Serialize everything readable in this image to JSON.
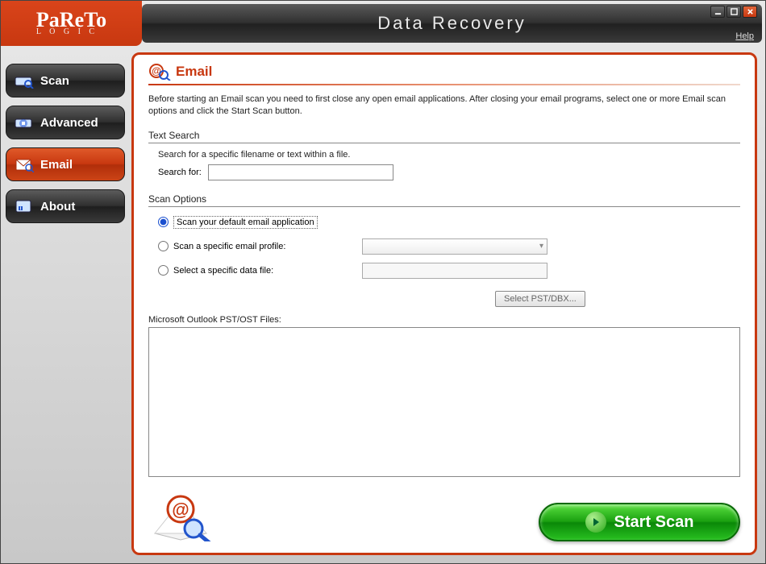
{
  "app": {
    "logo_top": "PaReTo",
    "logo_sub": "L O G I C",
    "title": "Data Recovery",
    "help": "Help"
  },
  "sidebar": {
    "items": [
      {
        "label": "Scan",
        "icon": "drive-scan-icon"
      },
      {
        "label": "Advanced",
        "icon": "drive-advanced-icon"
      },
      {
        "label": "Email",
        "icon": "email-icon"
      },
      {
        "label": "About",
        "icon": "about-icon"
      }
    ],
    "active_index": 2
  },
  "panel": {
    "title": "Email",
    "intro": "Before starting an Email scan you need to first close any open email applications. After closing your email programs, select one or more Email scan options and click the Start Scan button.",
    "text_search": {
      "heading": "Text Search",
      "hint": "Search for a specific filename or text within a file.",
      "label": "Search for:",
      "value": ""
    },
    "scan_options": {
      "heading": "Scan Options",
      "opt1": "Scan your default email application",
      "opt2": "Scan a specific email profile:",
      "opt3": "Select a specific data file:",
      "selected": "opt1",
      "profile_value": "",
      "datafile_value": "",
      "select_button": "Select PST/DBX..."
    },
    "files_label": "Microsoft Outlook PST/OST Files:",
    "start_button": "Start Scan"
  },
  "colors": {
    "brand_orange": "#c83810",
    "accent_green": "#1aa010"
  }
}
